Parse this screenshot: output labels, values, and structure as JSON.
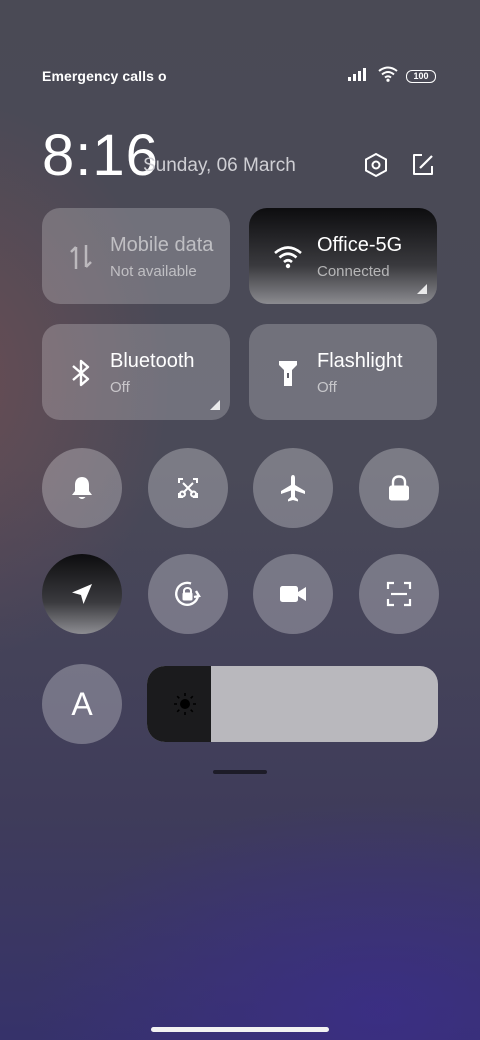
{
  "status_bar": {
    "carrier_text": "Emergency calls only",
    "battery_level": "100",
    "signal_icon": "signal-bars-icon",
    "wifi_icon": "wifi-icon"
  },
  "header": {
    "time": "8:16",
    "date": "Sunday, 06 March",
    "settings_icon": "settings-hexagon-icon",
    "edit_icon": "edit-icon"
  },
  "tiles": [
    {
      "title": "Mobile data",
      "subtitle": "Not available",
      "icon": "mobile-data-icon",
      "state": "disabled"
    },
    {
      "title": "Office-5G",
      "subtitle": "Connected",
      "icon": "wifi-icon",
      "state": "active"
    },
    {
      "title": "Bluetooth",
      "subtitle": "Off",
      "icon": "bluetooth-icon",
      "state": "off"
    },
    {
      "title": "Flashlight",
      "subtitle": "Off",
      "icon": "flashlight-icon",
      "state": "off"
    }
  ],
  "toggles_row1": [
    "bell-icon",
    "screenshot-crop-icon",
    "airplane-icon",
    "lock-icon"
  ],
  "toggles_row2": [
    "location-icon",
    "rotation-lock-icon",
    "video-camera-icon",
    "scan-icon"
  ],
  "font_button": {
    "label": "A"
  },
  "brightness": {
    "level": 0.22,
    "icon": "sun-icon"
  },
  "colors": {
    "tile_bg": "#5e5e68",
    "active": "#0d0d0f",
    "slider_track": "#b9b8bd"
  }
}
